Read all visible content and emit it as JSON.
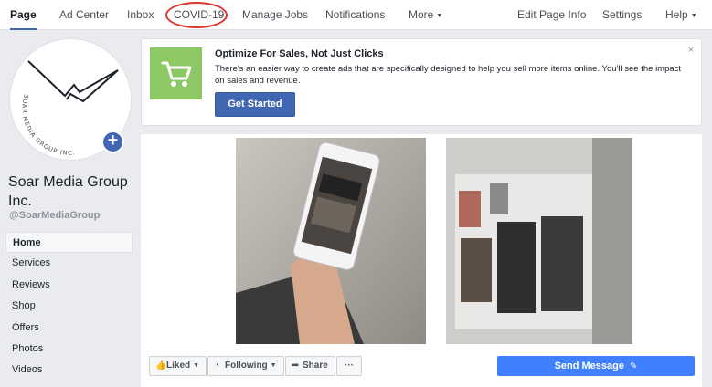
{
  "nav": {
    "items": [
      {
        "label": "Page"
      },
      {
        "label": "Ad Center"
      },
      {
        "label": "Inbox"
      },
      {
        "label": "COVID-19"
      },
      {
        "label": "Manage Jobs"
      },
      {
        "label": "Notifications"
      },
      {
        "label": "More"
      },
      {
        "label": "Edit Page Info"
      },
      {
        "label": "Settings"
      },
      {
        "label": "Help"
      }
    ]
  },
  "profile": {
    "logo_text": "SOAR MEDIA GROUP INC.",
    "name": "Soar Media Group Inc.",
    "handle": "@SoarMediaGroup"
  },
  "sidebar": {
    "items": [
      {
        "label": "Home"
      },
      {
        "label": "Services"
      },
      {
        "label": "Reviews"
      },
      {
        "label": "Shop"
      },
      {
        "label": "Offers"
      },
      {
        "label": "Photos"
      },
      {
        "label": "Videos"
      }
    ]
  },
  "promo": {
    "title": "Optimize For Sales, Not Just Clicks",
    "text": "There's an easier way to create ads that are specifically designed to help you sell more items online. You'll see the impact on sales and revenue.",
    "button": "Get Started",
    "close": "×"
  },
  "actions": {
    "liked": "Liked",
    "following": "Following",
    "share": "Share",
    "more": "···",
    "send_message": "Send Message"
  },
  "colors": {
    "brand": "#4267b2",
    "send": "#4080ff",
    "promo_icon": "#8cc864",
    "highlight_circle": "#e0332c"
  }
}
